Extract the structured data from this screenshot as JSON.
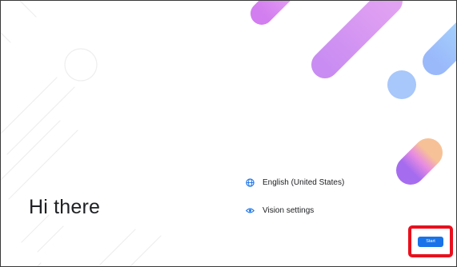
{
  "greeting": "Hi there",
  "options": [
    {
      "label": "English (United States)",
      "icon": "globe-icon"
    },
    {
      "label": "Vision settings",
      "icon": "eye-icon"
    }
  ],
  "start_button": {
    "label": "Start",
    "highlight_color": "#e8101d"
  },
  "colors": {
    "accent": "#1a73e8",
    "text": "#202124"
  }
}
